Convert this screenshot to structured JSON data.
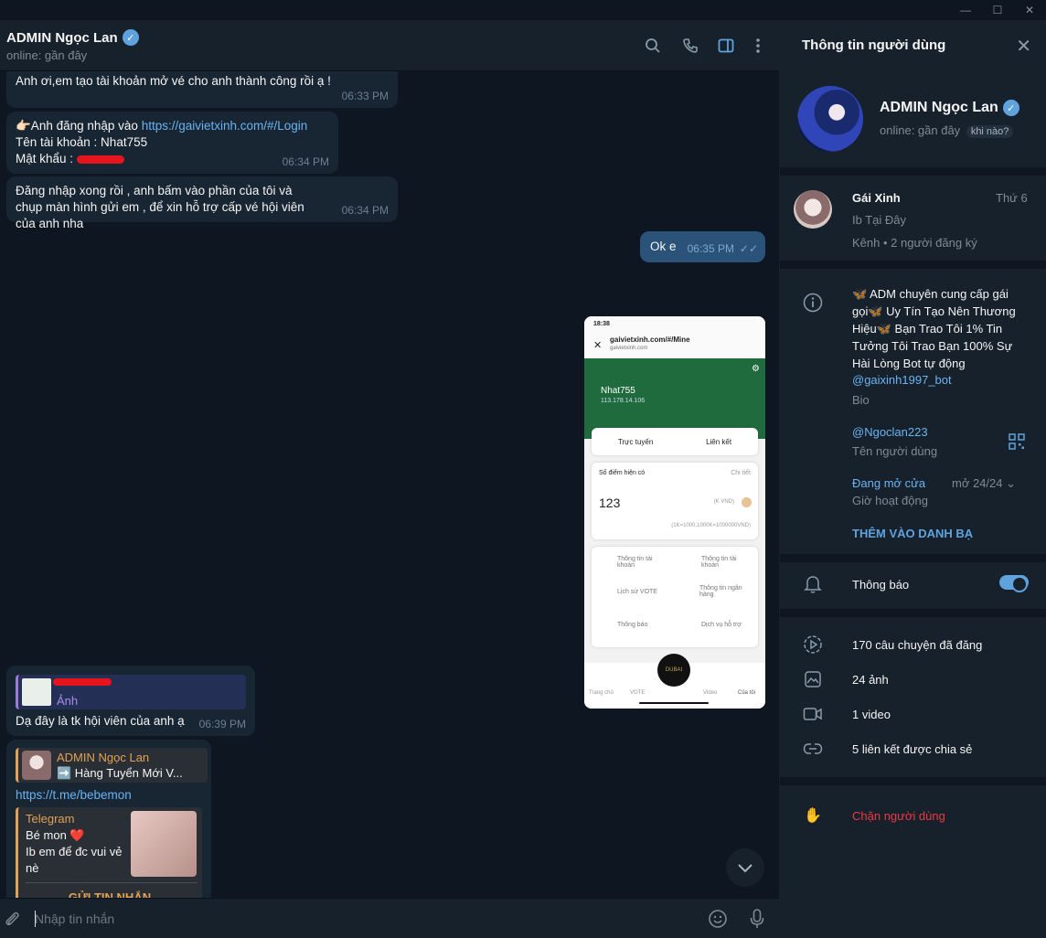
{
  "chat": {
    "name": "ADMIN Ngọc Lan",
    "status": "online: gần đây",
    "composer_placeholder": "Nhập tin nhắn"
  },
  "messages": {
    "m1_text": "Anh ơi,em tạo tài khoản mở vé cho anh thành công rồi ạ !",
    "m1_time": "06:33 PM",
    "m2_line1_prefix": "👉🏻Anh đăng nhập vào",
    "m2_link": "https://gaivietxinh.com/#/Login",
    "m2_line2": "Tên tài khoản : Nhat755",
    "m2_line3": "Mật khẩu :",
    "m2_time": "06:34 PM",
    "m3_text": "Đăng nhập xong rồi , anh bấm vào phần của tôi và chụp màn hình gửi em , để xin hỗ trợ cấp vé hội viên của anh nha",
    "m3_time": "06:34 PM",
    "m4_text": "Ok e",
    "m4_time": "06:35 PM",
    "m5_reply_label": "Ảnh",
    "m5_text": "Dạ đây là tk hội viên của anh ạ",
    "m5_time": "06:39 PM",
    "m6_fwd_name": "ADMIN Ngọc Lan",
    "m6_fwd_text": "➡️ Hàng Tuyển Mới V...",
    "m6_link": "https://t.me/bebemon",
    "m6_preview_site": "Telegram",
    "m6_preview_title": "Bé mon ❤️",
    "m6_preview_desc": "Ib em để đc vui vẻ nè",
    "m6_button": "GỬI TIN NHẮN"
  },
  "screenshot": {
    "clock": "18:38",
    "url": "gaivietxinh.com/#/Mine",
    "domain": "gaivietxinh.com",
    "username": "Nhat755",
    "ip": "113.178.14.106",
    "tab1": "Trực tuyến",
    "tab2": "Liên kết",
    "points_label": "Số điểm hiện có",
    "details": "Chi tiết",
    "points": "123",
    "unit": "(K VND)",
    "rate": "(1K=1000,1000K=1000000VND)",
    "grid": [
      "Thông tin tài khoản",
      "Thông tin tài khoản",
      "Lịch sử VOTE",
      "Thông tin ngân hàng",
      "Thông báo",
      "Dịch vụ hỗ trợ"
    ],
    "nav": [
      "Trang chủ",
      "VOTE",
      "",
      "Video",
      "Của tôi"
    ],
    "logo_text": "DUBAI"
  },
  "panel": {
    "title": "Thông tin người dùng",
    "name": "ADMIN Ngọc Lan",
    "online": "online: gần đây",
    "chip": "khi nào?",
    "channel_name": "Gái Xinh",
    "channel_day": "Thứ 6",
    "channel_sub": "Ib Tại Đây",
    "channel_meta": "Kênh • 2 người đăng ký",
    "bio": "🦋 ADM chuyên cung cấp gái gọi🦋 Uy Tín Tạo Nên Thương Hiệu🦋 Bạn Trao Tôi 1% Tin Tưởng Tôi Trao Bạn 100% Sự Hài Lòng Bot tự động",
    "bio_link": "@gaixinh1997_bot",
    "bio_label": "Bio",
    "username": "@Ngoclan223",
    "username_label": "Tên người dùng",
    "hours_open": "Đang mở cửa",
    "hours_value": "mở 24/24",
    "hours_label": "Giờ hoạt động",
    "add_contact": "THÊM VÀO DANH BẠ",
    "notifications": "Thông báo",
    "notifications_on": true,
    "stories": "170 câu chuyện đã đăng",
    "photos": "24 ảnh",
    "videos": "1 video",
    "links": "5 liên kết được chia sẻ",
    "block": "Chặn người dùng"
  },
  "colors": {
    "accent": "#5fa3de",
    "link": "#6ab3f3",
    "danger": "#ec3942",
    "forward": "#e2a153"
  }
}
